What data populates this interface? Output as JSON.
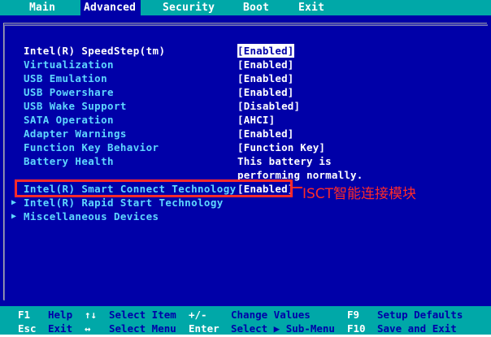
{
  "menu": {
    "tabs": [
      {
        "label": "Main"
      },
      {
        "label": "Advanced"
      },
      {
        "label": "Security"
      },
      {
        "label": "Boot"
      },
      {
        "label": "Exit"
      }
    ]
  },
  "settings": [
    {
      "label": "Intel(R) SpeedStep(tm)",
      "value": "[Enabled]"
    },
    {
      "label": "Virtualization",
      "value": "[Enabled]"
    },
    {
      "label": "USB Emulation",
      "value": "[Enabled]"
    },
    {
      "label": "USB Powershare",
      "value": "[Enabled]"
    },
    {
      "label": "USB Wake Support",
      "value": "[Disabled]"
    },
    {
      "label": "SATA Operation",
      "value": "[AHCI]"
    },
    {
      "label": "Adapter Warnings",
      "value": "[Enabled]"
    },
    {
      "label": "Function Key Behavior",
      "value": "[Function Key]"
    },
    {
      "label": "Battery Health",
      "value": "This battery is",
      "value2": "performing normally."
    },
    {
      "label": "Intel(R) Smart Connect Technology",
      "value": "[Enabled]"
    }
  ],
  "submenus": [
    {
      "label": "Intel(R) Rapid Start Technology"
    },
    {
      "label": "Miscellaneous Devices"
    }
  ],
  "annotation": {
    "text": "ISCT智能连接模块",
    "color": "#ff2a2a"
  },
  "status": {
    "row1": [
      {
        "key": "F1",
        "desc": "Help"
      },
      {
        "key": "↑↓",
        "desc": "Select Item"
      },
      {
        "key": "+/-",
        "desc": "Change Values"
      },
      {
        "key": "F9",
        "desc": "Setup Defaults"
      }
    ],
    "row2": [
      {
        "key": "Esc",
        "desc": "Exit"
      },
      {
        "key": "↔",
        "desc": "Select Menu"
      },
      {
        "key": "Enter",
        "desc": "Select ▶ Sub-Menu"
      },
      {
        "key": "F10",
        "desc": "Save and Exit"
      }
    ]
  },
  "colors": {
    "background": "#0000a8",
    "bar": "#00a8a8",
    "label": "#5fd7ff",
    "value": "#ffffff"
  }
}
